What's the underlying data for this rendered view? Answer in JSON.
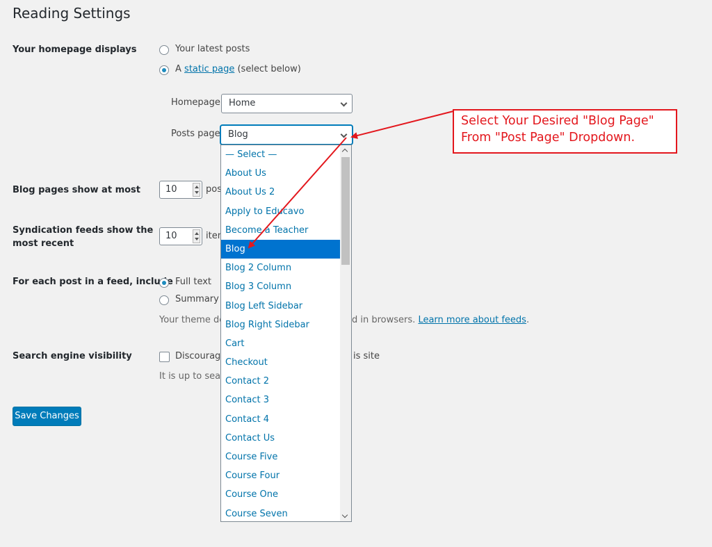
{
  "page": {
    "title": "Reading Settings"
  },
  "homepage_displays": {
    "label": "Your homepage displays",
    "latest_posts": "Your latest posts",
    "static_prefix": "A",
    "static_link": "static page",
    "static_suffix": "(select below)",
    "homepage_label": "Homepage:",
    "homepage_value": "Home",
    "posts_page_label": "Posts page:",
    "posts_page_value": "Blog"
  },
  "blog_pages": {
    "label": "Blog pages show at most",
    "value": "10",
    "unit": "pos"
  },
  "syndication": {
    "label_line1": "Syndication feeds show the",
    "label_line2": "most recent",
    "value": "10",
    "unit": "iten"
  },
  "feed_include": {
    "label": "For each post in a feed, include",
    "full_text": "Full text",
    "summary": "Summary",
    "help_prefix": "Your theme det",
    "help_middle": "d in browsers.",
    "help_link": "Learn more about feeds",
    "help_suffix": "."
  },
  "search_visibility": {
    "label": "Search engine visibility",
    "checkbox_prefix": "Discourage",
    "checkbox_suffix": "is site",
    "help": "It is up to searc"
  },
  "save_button": "Save Changes",
  "dropdown": {
    "options": [
      "— Select —",
      "About Us",
      "About Us 2",
      "Apply to Educavo",
      "Become a Teacher",
      "Blog",
      "Blog 2 Column",
      "Blog 3 Column",
      "Blog Left Sidebar",
      "Blog Right Sidebar",
      "Cart",
      "Checkout",
      "Contact 2",
      "Contact 3",
      "Contact 4",
      "Contact Us",
      "Course Five",
      "Course Four",
      "Course One",
      "Course Seven"
    ],
    "selected": "Blog"
  },
  "annotation": {
    "line1": "Select Your Desired \"Blog Page\"",
    "line2": "From \"Post Page\" Dropdown.",
    "color": "#e3171d"
  }
}
